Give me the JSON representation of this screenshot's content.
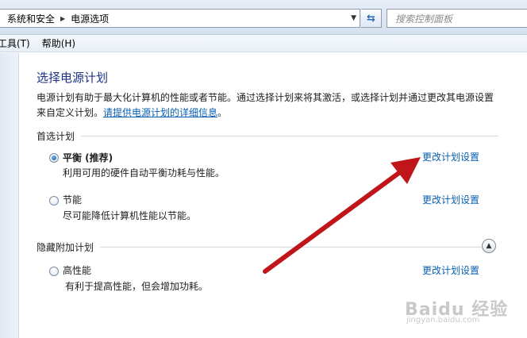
{
  "address_bar": {
    "breadcrumb": [
      "系统和安全",
      "电源选项"
    ],
    "search_placeholder": "搜索控制面板"
  },
  "menu": [
    "工具(T)",
    "帮助(H)"
  ],
  "page": {
    "title": "选择电源计划",
    "description_line1": "电源计划有助于最大化计算机的性能或者节能。通过选择计划来将其激活，或选择计划并通过更改其电源设置",
    "description_line2_prefix": "来自定义计划。",
    "description_link": "请提供电源计划的详细信息",
    "description_line2_suffix": "。"
  },
  "preferred_plans": {
    "header": "首选计划",
    "plans": [
      {
        "name": "平衡 (推荐)",
        "description": "利用可用的硬件自动平衡功耗与性能。",
        "link": "更改计划设置",
        "selected": true
      },
      {
        "name": "节能",
        "description": "尽可能降低计算机性能以节能。",
        "link": "更改计划设置",
        "selected": false
      }
    ]
  },
  "hidden_plans": {
    "header": "隐藏附加计划",
    "plans": [
      {
        "name": "高性能",
        "description": "有利于提高性能，但会增加功耗。",
        "link": "更改计划设置",
        "selected": false
      }
    ]
  },
  "annotation": {
    "arrow_color": "#c0161b"
  },
  "watermark": {
    "brand": "Baidu 经验",
    "url": "jingyan.baidu.com"
  },
  "colors": {
    "link": "#0a5fb3",
    "title": "#1e3287"
  }
}
